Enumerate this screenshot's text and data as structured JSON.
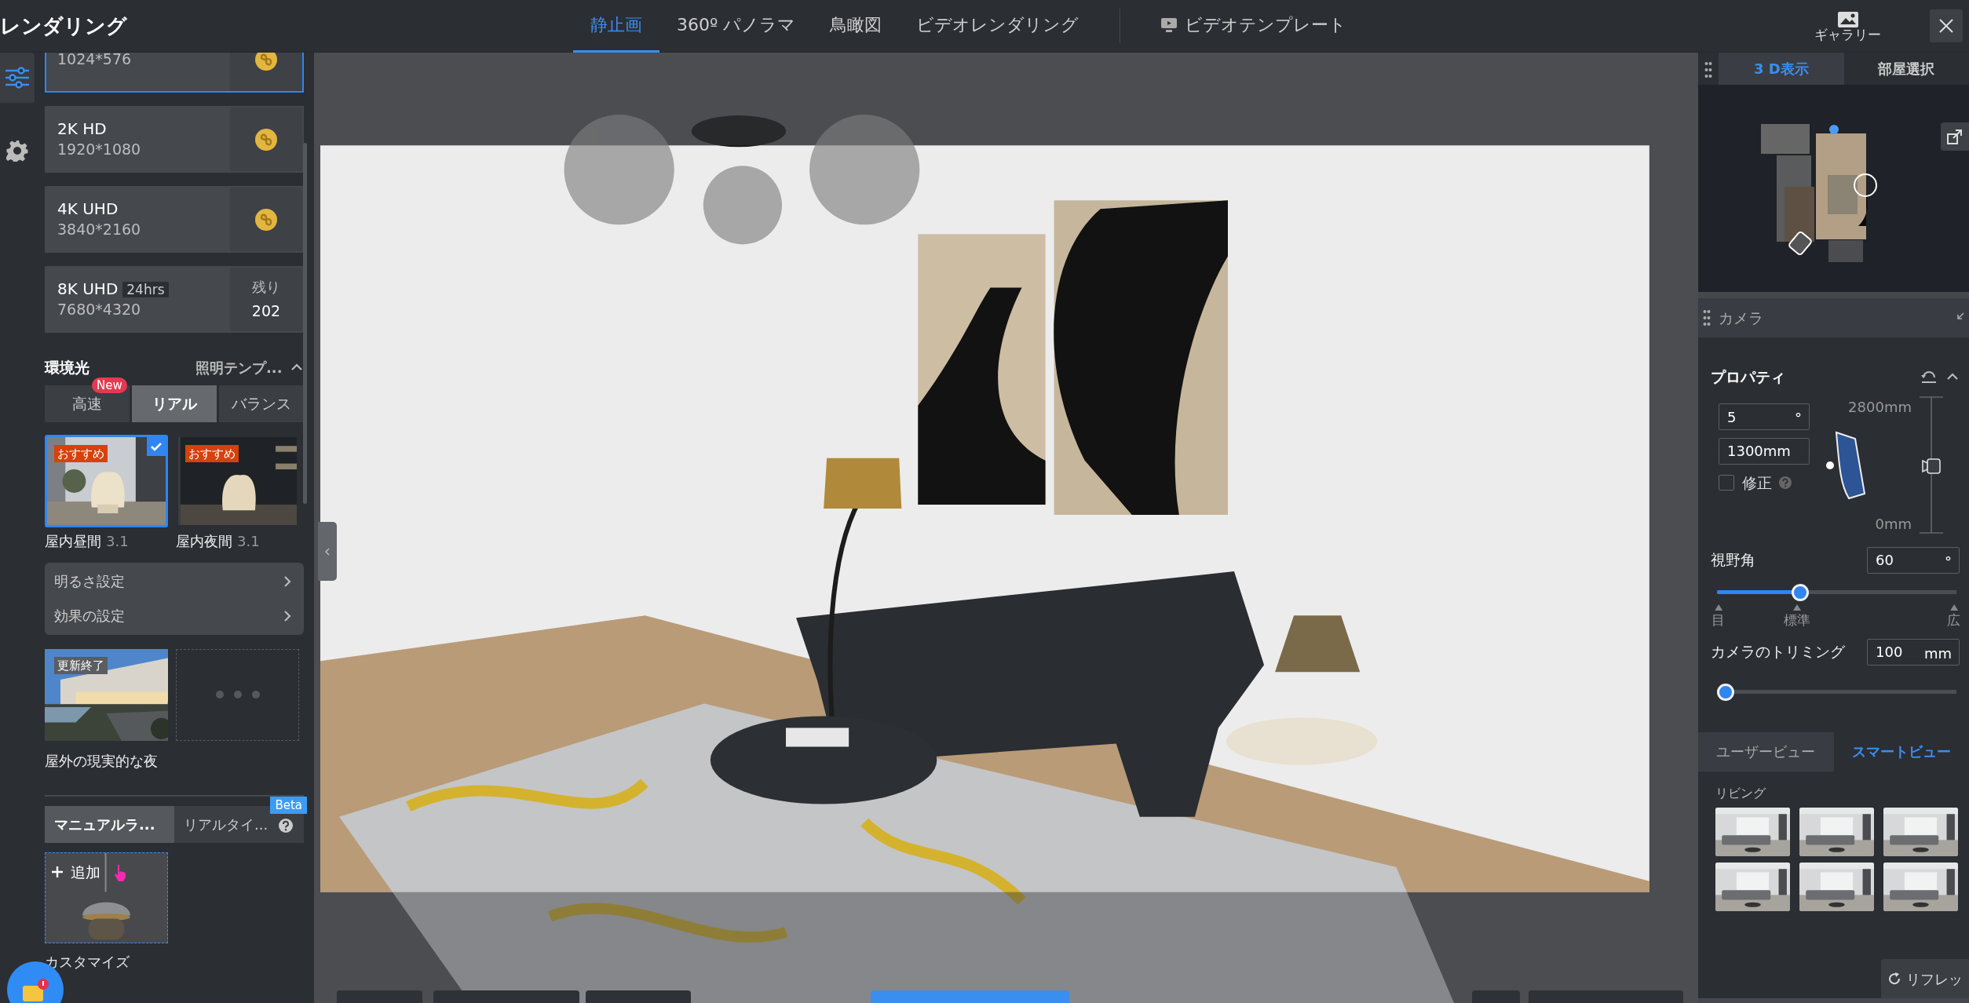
{
  "app_title": "レンダリング",
  "mode_tabs": [
    {
      "label": "静止画",
      "selected": true
    },
    {
      "label": "360º パノラマ",
      "selected": false
    },
    {
      "label": "鳥瞰図",
      "selected": false
    },
    {
      "label": "ビデオレンダリング",
      "selected": false
    }
  ],
  "video_template": {
    "label": "ビデオテンプレート"
  },
  "gallery": {
    "label": "ギャラリー"
  },
  "side_tools": [
    {
      "kind": "sliders",
      "selected": true
    },
    {
      "kind": "gear",
      "selected": false
    }
  ],
  "resolutions": [
    {
      "size": "1024*576",
      "selected": true,
      "side": {
        "kind": "coin"
      }
    },
    {
      "name": "2K HD",
      "size": "1920*1080",
      "selected": false,
      "side": {
        "kind": "coin"
      }
    },
    {
      "name": "4K UHD",
      "size": "3840*2160",
      "selected": false,
      "side": {
        "kind": "coin"
      }
    },
    {
      "name": "8K UHD",
      "tag": "24hrs",
      "size": "7680*4320",
      "selected": false,
      "side": {
        "kind": "remaining",
        "label": "残り",
        "value": "202"
      }
    }
  ],
  "lighting": {
    "title": "環境光",
    "template_label": "照明テンプ...",
    "expanded": true,
    "modes": [
      {
        "label": "高速",
        "selected": false,
        "badge": "New"
      },
      {
        "label": "リアル",
        "selected": true
      },
      {
        "label": "バランス",
        "selected": false
      }
    ],
    "presets": [
      {
        "name": "屋内昼間",
        "version": "3.1",
        "tag": "おすすめ",
        "selected": true
      },
      {
        "name": "屋内夜間",
        "version": "3.1",
        "tag": "おすすめ",
        "selected": false
      }
    ],
    "settings": [
      {
        "label": "明るさ設定"
      },
      {
        "label": "効果の設定"
      }
    ],
    "outdoor": {
      "name": "屋外の現実的な夜",
      "tag": "更新終了"
    }
  },
  "lights": {
    "tabs": [
      {
        "label": "マニュアルラ...",
        "selected": true
      },
      {
        "label": "リアルタイ...",
        "selected": false,
        "badge": "Beta"
      }
    ],
    "add_label": "追加",
    "custom_label": "カスタマイズ"
  },
  "view_tabs": [
    {
      "label": "3 D表示",
      "selected": true
    },
    {
      "label": "部屋選択",
      "selected": false
    }
  ],
  "camera": {
    "title": "カメラ",
    "section": "プロパティ",
    "expanded": true,
    "angle": {
      "value": "5",
      "unit": "°"
    },
    "height": {
      "value": "1300mm"
    },
    "correction": {
      "label": "修正",
      "checked": false
    },
    "gauge_top": "2800mm",
    "gauge_bottom": "0mm",
    "fov": {
      "label": "視野角",
      "value": "60",
      "unit": "°",
      "level": 0.335,
      "ticks": [
        "目",
        "標準",
        "広"
      ]
    },
    "clip": {
      "label": "カメラのトリミング",
      "value": "100",
      "unit": "mm",
      "level": 0
    }
  },
  "shot_tabs": [
    {
      "label": "ユーザービュー",
      "selected": false
    },
    {
      "label": "スマートビュー",
      "selected": true
    }
  ],
  "smart_views": {
    "category": "リビング"
  },
  "refresh": {
    "label": "リフレッ"
  }
}
